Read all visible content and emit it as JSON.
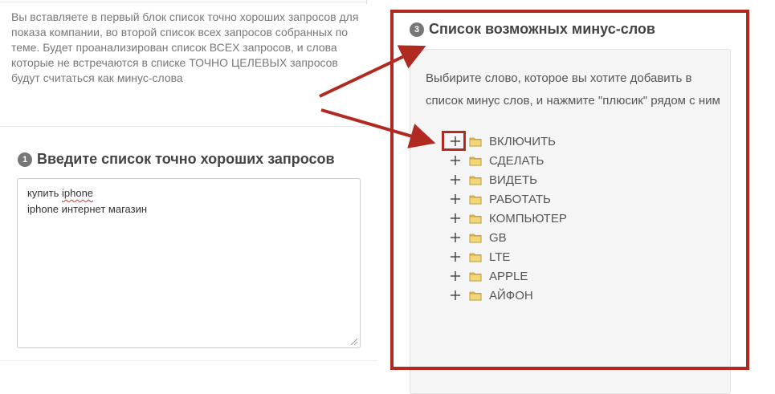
{
  "intro": {
    "text": "Вы вставляете в первый блок список точно хороших запросов для показа компании, во второй список всех запросов собранных по теме. Будет проанализирован список ВСЕХ запросов, и слова которые не встречаются в списке ТОЧНО ЦЕЛЕВЫХ запросов будут считаться как минус-слова"
  },
  "good_queries": {
    "step": "1",
    "title": "Введите список точно хороших запросов",
    "lines": [
      {
        "prefix": "купить ",
        "word": "iphone"
      },
      {
        "prefix": "iphone интернет магазин",
        "word": ""
      }
    ]
  },
  "minus_words": {
    "step": "3",
    "title": "Список возможных минус-слов",
    "instruction": "Выбирите слово, которое вы хотите добавить в список минус слов, и нажмите \"плюсик\" рядом с ним",
    "items": [
      "ВКЛЮЧИТЬ",
      "СДЕЛАТЬ",
      "ВИДЕТЬ",
      "РАБОТАТЬ",
      "КОМПЬЮТЕР",
      "GB",
      "LTE",
      "APPLE",
      "АЙФОН"
    ]
  },
  "colors": {
    "highlight": "#b02a22",
    "panel": "#f5f5f5",
    "badge": "#777777"
  }
}
